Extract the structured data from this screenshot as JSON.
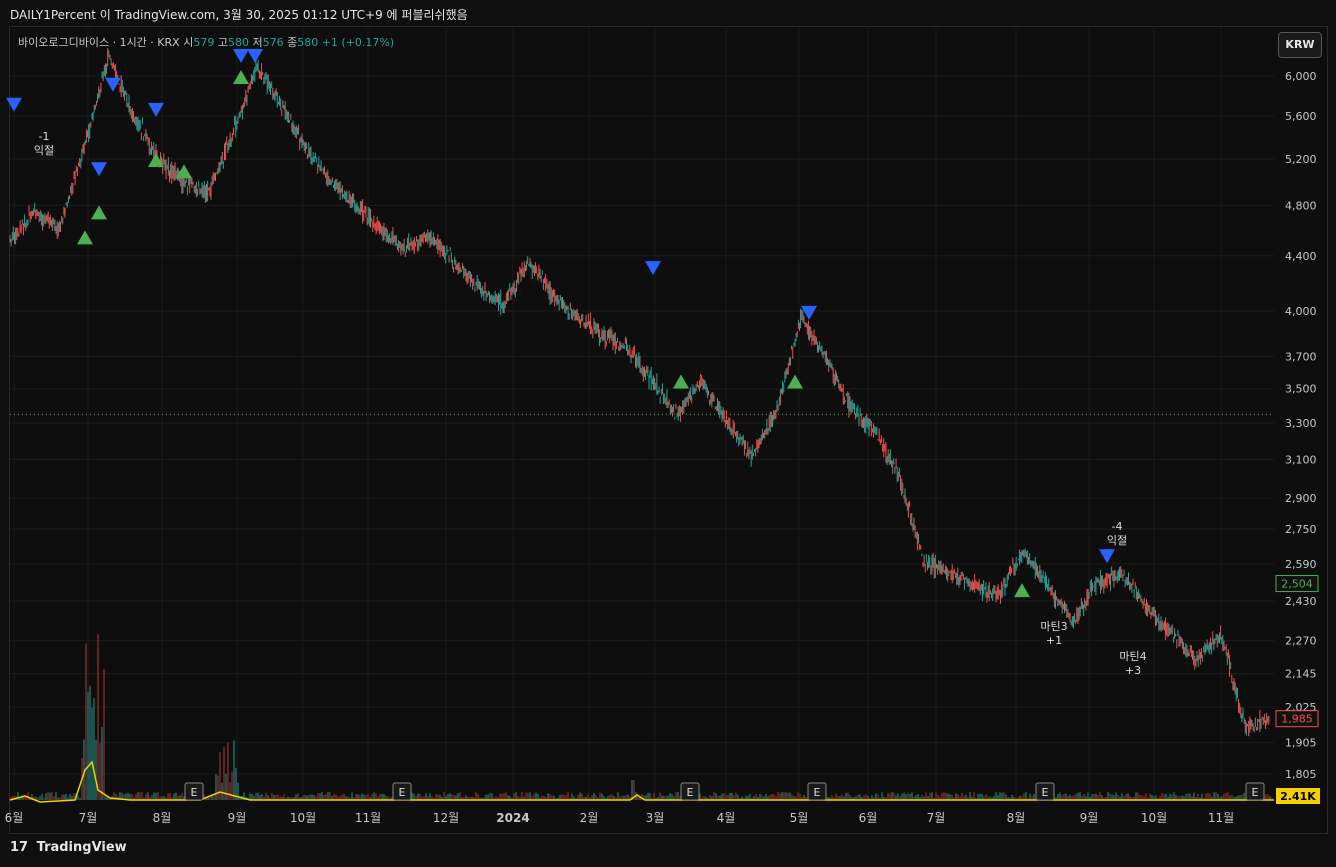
{
  "header": {
    "text": "DAILY1Percent 이 TradingView.com, 3월 30, 2025 01:12 UTC+9 에 퍼블리쉬했음"
  },
  "legend": {
    "symbol": "바이오로그디바이스 · 1시간 · KRX",
    "open_label": "시",
    "open_value": "579",
    "high_label": "고",
    "high_value": "580",
    "low_label": "저",
    "low_value": "576",
    "close_label": "종",
    "close_value": "580",
    "change": "+1 (+0.17%)"
  },
  "currency_button": "KRW",
  "footer": {
    "logo": "17",
    "brand": "TradingView"
  },
  "colors": {
    "up": "#26a69a",
    "down": "#ef5350",
    "buy_marker": "#4caf50",
    "sell_marker": "#2962ff",
    "price_tag_green": "#4caf50",
    "price_tag_red": "#ef5350",
    "volume_ma": "#f5d000"
  },
  "chart_data": {
    "type": "candlestick",
    "y_ticks": [
      "6,000",
      "5,600",
      "5,200",
      "4,800",
      "4,400",
      "4,000",
      "3,700",
      "3,500",
      "3,300",
      "3,100",
      "2,900",
      "2,750",
      "2,590",
      "2,430",
      "2,270",
      "2,145",
      "2,025",
      "1,905",
      "1,805"
    ],
    "x_ticks": [
      "6월",
      "7월",
      "8월",
      "9월",
      "10월",
      "11월",
      "12월",
      "2024",
      "2월",
      "3월",
      "4월",
      "5월",
      "6월",
      "7월",
      "8월",
      "9월",
      "10월",
      "11월"
    ],
    "x_range": [
      "2023-06",
      "2024-11"
    ],
    "y_range": [
      1805,
      6000
    ],
    "log_scale": true,
    "dotted_line_price": 3350,
    "price_tags": [
      {
        "label": "2,504",
        "value": 2504,
        "color": "#4caf50"
      },
      {
        "label": "1,985",
        "value": 1985,
        "color": "#ef5350"
      }
    ],
    "volume_tag": "2.41K",
    "earnings_label": "E",
    "earnings_dates": [
      "2023-08",
      "2023-11",
      "2024-03",
      "2024-05",
      "2024-08",
      "2024-11"
    ],
    "price_path": [
      [
        "2023-06",
        4500
      ],
      [
        "2023-06",
        4750
      ],
      [
        "2023-07",
        4600
      ],
      [
        "2023-07",
        5300
      ],
      [
        "2023-07",
        6200
      ],
      [
        "2023-07",
        5600
      ],
      [
        "2023-08",
        5200
      ],
      [
        "2023-08",
        5000
      ],
      [
        "2023-08",
        4900
      ],
      [
        "2023-08",
        5400
      ],
      [
        "2023-09",
        6100
      ],
      [
        "2023-09",
        5700
      ],
      [
        "2023-09",
        5300
      ],
      [
        "2023-09",
        5000
      ],
      [
        "2023-10",
        4800
      ],
      [
        "2023-10",
        4600
      ],
      [
        "2023-11",
        4450
      ],
      [
        "2023-11",
        4550
      ],
      [
        "2023-12",
        4350
      ],
      [
        "2023-12",
        4150
      ],
      [
        "2024-01",
        4050
      ],
      [
        "2024-01",
        4350
      ],
      [
        "2024-01",
        4100
      ],
      [
        "2024-02",
        3950
      ],
      [
        "2024-02",
        3850
      ],
      [
        "2024-03",
        3750
      ],
      [
        "2024-03",
        3550
      ],
      [
        "2024-03",
        3350
      ],
      [
        "2024-04",
        3550
      ],
      [
        "2024-04",
        3300
      ],
      [
        "2024-05",
        3120
      ],
      [
        "2024-05",
        3350
      ],
      [
        "2024-05",
        3950
      ],
      [
        "2024-06",
        3700
      ],
      [
        "2024-06",
        3400
      ],
      [
        "2024-06",
        3250
      ],
      [
        "2024-07",
        3000
      ],
      [
        "2024-07",
        2600
      ],
      [
        "2024-07",
        2550
      ],
      [
        "2024-08",
        2500
      ],
      [
        "2024-08",
        2450
      ],
      [
        "2024-08",
        2650
      ],
      [
        "2024-09",
        2500
      ],
      [
        "2024-09",
        2350
      ],
      [
        "2024-09",
        2500
      ],
      [
        "2024-10",
        2550
      ],
      [
        "2024-10",
        2400
      ],
      [
        "2024-10",
        2300
      ],
      [
        "2024-11",
        2200
      ],
      [
        "2024-11",
        2300
      ],
      [
        "2024-11",
        1950
      ],
      [
        "2024-11",
        1985
      ]
    ],
    "signals": [
      {
        "type": "sell",
        "date": "2023-06",
        "price": 5700
      },
      {
        "type": "sell",
        "date": "2023-07",
        "price": 5100
      },
      {
        "type": "sell",
        "date": "2023-07",
        "price": 5900
      },
      {
        "type": "sell",
        "date": "2023-08",
        "price": 5650
      },
      {
        "type": "sell",
        "date": "2023-09",
        "price": 6200
      },
      {
        "type": "sell",
        "date": "2023-09",
        "price": 6200
      },
      {
        "type": "sell",
        "date": "2024-03",
        "price": 4300
      },
      {
        "type": "sell",
        "date": "2024-05",
        "price": 3980
      },
      {
        "type": "sell",
        "date": "2024-09",
        "price": 2620
      },
      {
        "type": "buy",
        "date": "2023-07",
        "price": 4550
      },
      {
        "type": "buy",
        "date": "2023-07",
        "price": 4750
      },
      {
        "type": "buy",
        "date": "2023-08",
        "price": 5100
      },
      {
        "type": "buy",
        "date": "2023-08",
        "price": 5200
      },
      {
        "type": "buy",
        "date": "2023-09",
        "price": 6000
      },
      {
        "type": "buy",
        "date": "2024-03",
        "price": 3550
      },
      {
        "type": "buy",
        "date": "2024-05",
        "price": 3550
      },
      {
        "type": "buy",
        "date": "2024-08",
        "price": 2480
      }
    ],
    "annotations": [
      {
        "label": "-1",
        "sublabel": "익절",
        "date": "2023-06"
      },
      {
        "label": "-4",
        "sublabel": "익절",
        "date": "2024-09"
      },
      {
        "label": "마틴3",
        "sublabel": "+1",
        "date": "2024-08"
      },
      {
        "label": "마틴4",
        "sublabel": "+3",
        "date": "2024-09"
      }
    ]
  }
}
